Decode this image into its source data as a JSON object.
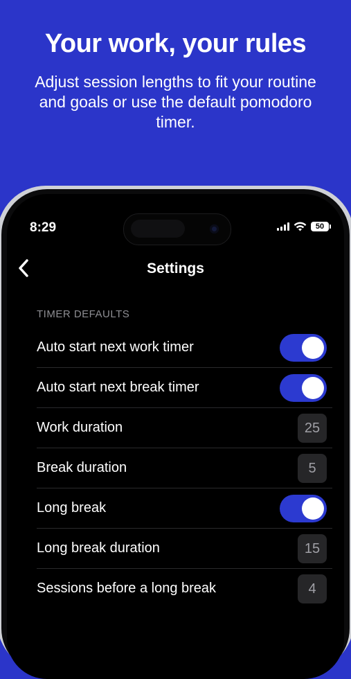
{
  "promo": {
    "headline": "Your work,  your rules",
    "subline": "Adjust session lengths to fit your routine and goals or use the default pomodoro timer."
  },
  "status_bar": {
    "time": "8:29",
    "battery": "50"
  },
  "nav": {
    "title": "Settings"
  },
  "section": {
    "label": "TIMER DEFAULTS"
  },
  "rows": [
    {
      "label": "Auto start next work timer",
      "type": "toggle",
      "on": true
    },
    {
      "label": "Auto start next break timer",
      "type": "toggle",
      "on": true
    },
    {
      "label": "Work duration",
      "type": "value",
      "value": "25"
    },
    {
      "label": "Break duration",
      "type": "value",
      "value": "5"
    },
    {
      "label": "Long break",
      "type": "toggle",
      "on": true
    },
    {
      "label": "Long break duration",
      "type": "value",
      "value": "15"
    },
    {
      "label": "Sessions before a long break",
      "type": "value",
      "value": "4"
    }
  ],
  "colors": {
    "background": "#2b35c9",
    "toggle_on": "#2c3ad0"
  }
}
